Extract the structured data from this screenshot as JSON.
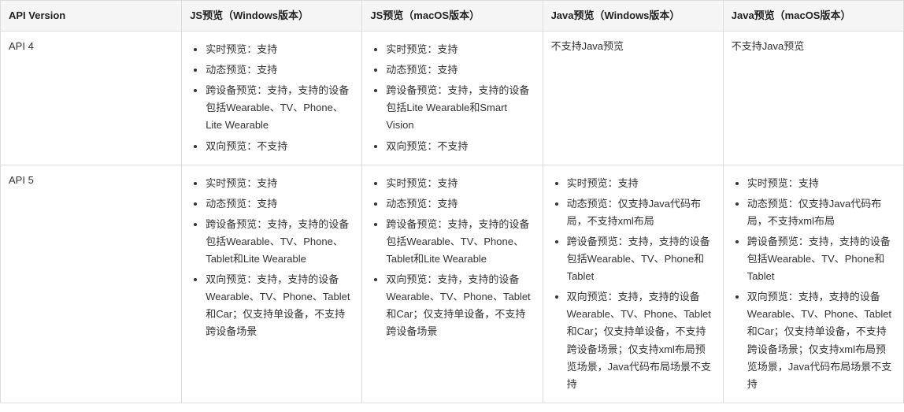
{
  "headers": [
    "API Version",
    "JS预览（Windows版本）",
    "JS预览（macOS版本）",
    "Java预览（Windows版本）",
    "Java预览（macOS版本）"
  ],
  "rows": [
    {
      "api": "API 4",
      "cells": [
        {
          "type": "list",
          "items": [
            "实时预览：支持",
            "动态预览：支持",
            "跨设备预览：支持，支持的设备包括Wearable、TV、Phone、Lite Wearable",
            "双向预览：不支持"
          ]
        },
        {
          "type": "list",
          "items": [
            "实时预览：支持",
            "动态预览：支持",
            "跨设备预览：支持，支持的设备包括Lite Wearable和Smart Vision",
            "双向预览：不支持"
          ]
        },
        {
          "type": "text",
          "text": "不支持Java预览"
        },
        {
          "type": "text",
          "text": "不支持Java预览"
        }
      ]
    },
    {
      "api": "API 5",
      "cells": [
        {
          "type": "list",
          "items": [
            "实时预览：支持",
            "动态预览：支持",
            "跨设备预览：支持，支持的设备包括Wearable、TV、Phone、Tablet和Lite Wearable",
            "双向预览：支持，支持的设备Wearable、TV、Phone、Tablet和Car；仅支持单设备，不支持跨设备场景"
          ]
        },
        {
          "type": "list",
          "items": [
            "实时预览：支持",
            "动态预览：支持",
            "跨设备预览：支持，支持的设备包括Wearable、TV、Phone、Tablet和Lite Wearable",
            "双向预览：支持，支持的设备Wearable、TV、Phone、Tablet和Car；仅支持单设备，不支持跨设备场景"
          ]
        },
        {
          "type": "list",
          "items": [
            "实时预览：支持",
            "动态预览：仅支持Java代码布局，不支持xml布局",
            "跨设备预览：支持，支持的设备包括Wearable、TV、Phone和Tablet",
            "双向预览：支持，支持的设备Wearable、TV、Phone、Tablet和Car；仅支持单设备，不支持跨设备场景；仅支持xml布局预览场景，Java代码布局场景不支持"
          ]
        },
        {
          "type": "list",
          "items": [
            "实时预览：支持",
            "动态预览：仅支持Java代码布局，不支持xml布局",
            "跨设备预览：支持，支持的设备包括Wearable、TV、Phone和Tablet",
            "双向预览：支持，支持的设备Wearable、TV、Phone、Tablet和Car；仅支持单设备，不支持跨设备场景；仅支持xml布局预览场景，Java代码布局场景不支持"
          ]
        }
      ]
    }
  ]
}
